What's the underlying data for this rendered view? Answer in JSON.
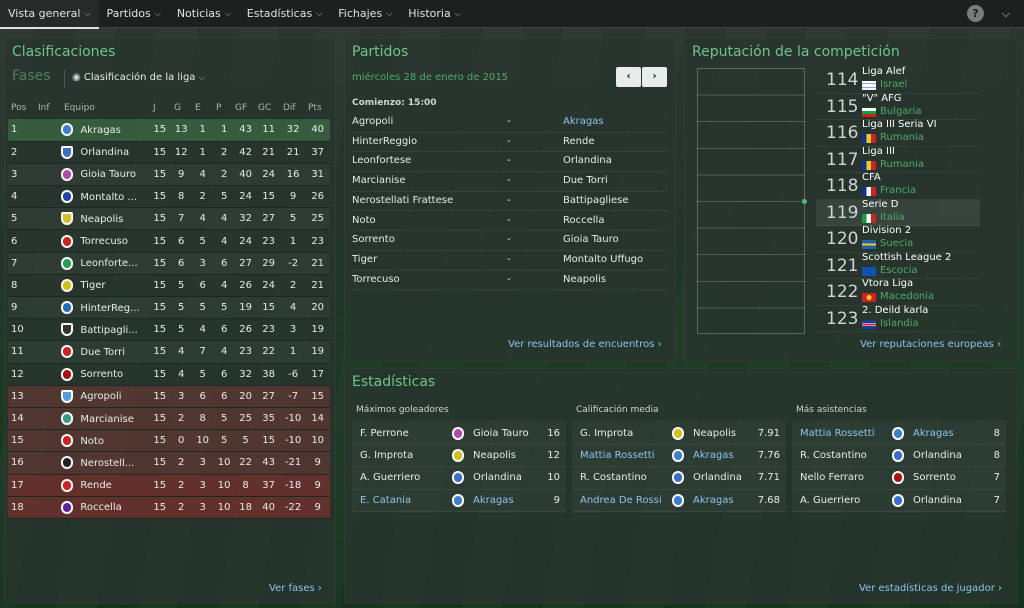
{
  "nav": {
    "tabs": [
      "Vista general",
      "Partidos",
      "Noticias",
      "Estadísticas",
      "Fichajes",
      "Historia"
    ],
    "help": "?"
  },
  "clasif": {
    "title": "Clasificaciones",
    "subtitle": "Fases",
    "dropdown": "Clasificación de la liga",
    "headers": [
      "Pos",
      "Inf",
      "Equipo",
      "J",
      "G",
      "E",
      "P",
      "GF",
      "GC",
      "Dif",
      "Pts"
    ],
    "rows": [
      [
        "1",
        "Akragas",
        "15",
        "13",
        "1",
        "1",
        "43",
        "11",
        "32",
        "40"
      ],
      [
        "2",
        "Orlandina",
        "15",
        "12",
        "1",
        "2",
        "42",
        "21",
        "21",
        "37"
      ],
      [
        "3",
        "Gioia Tauro",
        "15",
        "9",
        "4",
        "2",
        "40",
        "24",
        "16",
        "31"
      ],
      [
        "4",
        "Montalto ...",
        "15",
        "8",
        "2",
        "5",
        "24",
        "15",
        "9",
        "26"
      ],
      [
        "5",
        "Neapolis",
        "15",
        "7",
        "4",
        "4",
        "32",
        "27",
        "5",
        "25"
      ],
      [
        "6",
        "Torrecuso",
        "15",
        "6",
        "5",
        "4",
        "24",
        "23",
        "1",
        "23"
      ],
      [
        "7",
        "Leonforte...",
        "15",
        "6",
        "3",
        "6",
        "27",
        "29",
        "-2",
        "21"
      ],
      [
        "8",
        "Tiger",
        "15",
        "5",
        "6",
        "4",
        "26",
        "24",
        "2",
        "21"
      ],
      [
        "9",
        "HinterReg...",
        "15",
        "5",
        "5",
        "5",
        "19",
        "15",
        "4",
        "20"
      ],
      [
        "10",
        "Battipagli...",
        "15",
        "5",
        "4",
        "6",
        "26",
        "23",
        "3",
        "19"
      ],
      [
        "11",
        "Due Torri",
        "15",
        "4",
        "7",
        "4",
        "23",
        "22",
        "1",
        "19"
      ],
      [
        "12",
        "Sorrento",
        "15",
        "4",
        "5",
        "6",
        "32",
        "38",
        "-6",
        "17"
      ],
      [
        "13",
        "Agropoli",
        "15",
        "3",
        "6",
        "6",
        "20",
        "27",
        "-7",
        "15"
      ],
      [
        "14",
        "Marcianise",
        "15",
        "2",
        "8",
        "5",
        "25",
        "35",
        "-10",
        "14"
      ],
      [
        "15",
        "Noto",
        "15",
        "0",
        "10",
        "5",
        "5",
        "15",
        "-10",
        "10"
      ],
      [
        "16",
        "Nerostell...",
        "15",
        "2",
        "3",
        "10",
        "22",
        "43",
        "-21",
        "9"
      ],
      [
        "17",
        "Rende",
        "15",
        "2",
        "3",
        "10",
        "8",
        "37",
        "-18",
        "9"
      ],
      [
        "18",
        "Roccella",
        "15",
        "2",
        "3",
        "10",
        "18",
        "40",
        "-22",
        "9"
      ]
    ],
    "colors": [
      "#3a7fd0",
      "#3a6fd0",
      "#b04ab0",
      "#2040b0",
      "#d4c020",
      "#d02020",
      "#20a050",
      "#d0c010",
      "#2070c0",
      "#333333",
      "#d02020",
      "#b01010",
      "#4aa0e0",
      "#30a080",
      "#d02020",
      "#222222",
      "#d02020",
      "#6020a0"
    ],
    "link": "Ver fases"
  },
  "partidos": {
    "title": "Partidos",
    "date": "miércoles 28 de enero de 2015",
    "start": "Comienzo: 15:00",
    "matches": [
      [
        "Agropoli",
        "-",
        "Akragas"
      ],
      [
        "HinterReggio",
        "-",
        "Rende"
      ],
      [
        "Leonfortese",
        "-",
        "Orlandina"
      ],
      [
        "Marcianise",
        "-",
        "Due Torri"
      ],
      [
        "Nerostellati Frattese",
        "-",
        "Battipagliese"
      ],
      [
        "Noto",
        "-",
        "Roccella"
      ],
      [
        "Sorrento",
        "-",
        "Gioia Tauro"
      ],
      [
        "Tiger",
        "-",
        "Montalto Uffugo"
      ],
      [
        "Torrecuso",
        "-",
        "Neapolis"
      ]
    ],
    "link": "Ver resultados de encuentros"
  },
  "reputacion": {
    "title": "Reputación de la competición",
    "rows": [
      [
        "114",
        "Liga Alef",
        "Israel"
      ],
      [
        "115",
        "\"V\" AFG",
        "Bulgaria"
      ],
      [
        "116",
        "Liga III Seria VI",
        "Rumania"
      ],
      [
        "117",
        "Liga III",
        "Rumania"
      ],
      [
        "118",
        "CFA",
        "Francia"
      ],
      [
        "119",
        "Serie D",
        "Italia"
      ],
      [
        "120",
        "Division 2",
        "Suecia"
      ],
      [
        "121",
        "Scottish League 2",
        "Escocia"
      ],
      [
        "122",
        "Vtora Liga",
        "Macedonia"
      ],
      [
        "123",
        "2. Deild karla",
        "Islandia"
      ]
    ],
    "link": "Ver reputaciones europeas"
  },
  "estadisticas": {
    "title": "Estadísticas",
    "cols": [
      {
        "label": "Máximos goleadores",
        "rows": [
          [
            "F. Perrone",
            "Gioia Tauro",
            "16"
          ],
          [
            "G. Improta",
            "Neapolis",
            "12"
          ],
          [
            "A. Guerriero",
            "Orlandina",
            "10"
          ],
          [
            "E. Catania",
            "Akragas",
            "9"
          ]
        ]
      },
      {
        "label": "Calificación media",
        "rows": [
          [
            "G. Improta",
            "Neapolis",
            "7.91"
          ],
          [
            "Mattia Rossetti",
            "Akragas",
            "7.76"
          ],
          [
            "R. Costantino",
            "Orlandina",
            "7.71"
          ],
          [
            "Andrea De Rossi",
            "Akragas",
            "7.68"
          ]
        ]
      },
      {
        "label": "Más asistencias",
        "rows": [
          [
            "Mattia Rossetti",
            "Akragas",
            "8"
          ],
          [
            "R. Costantino",
            "Orlandina",
            "8"
          ],
          [
            "Nello Ferraro",
            "Sorrento",
            "7"
          ],
          [
            "A. Guerriero",
            "Orlandina",
            "7"
          ]
        ]
      }
    ],
    "link": "Ver estadísticas de jugador"
  }
}
